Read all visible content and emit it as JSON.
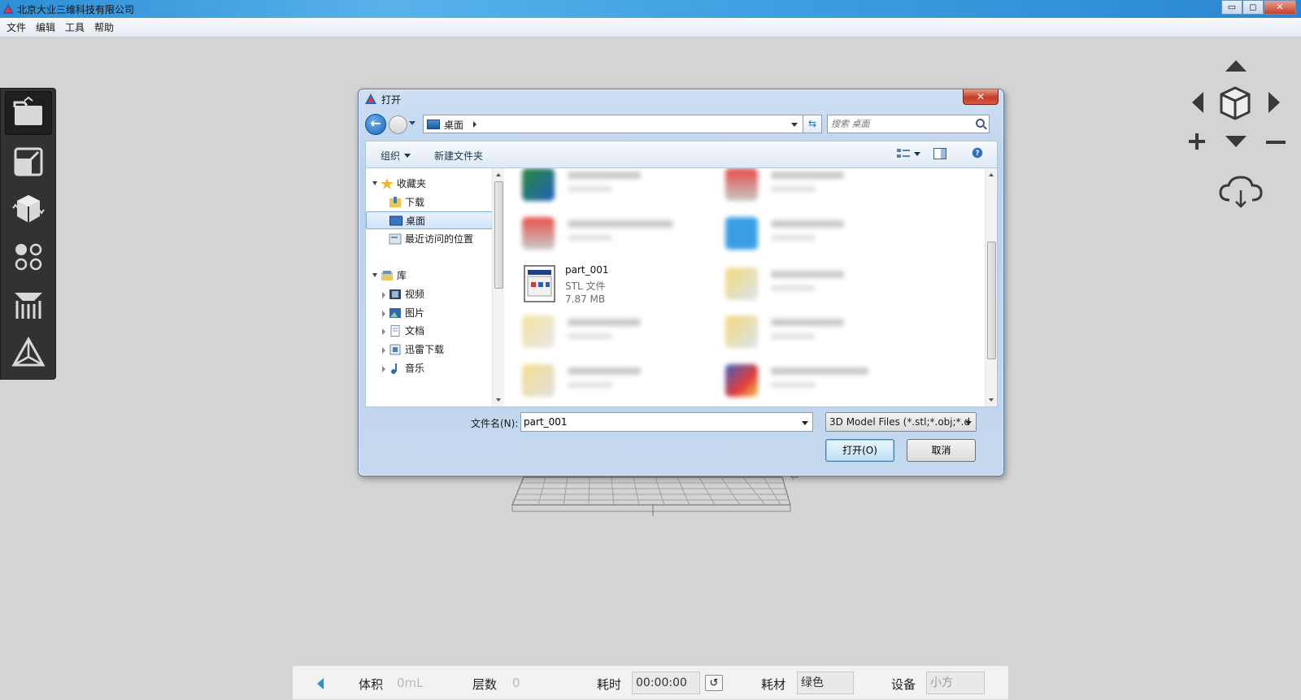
{
  "window": {
    "title": "北京大业三维科技有限公司",
    "buttons": {
      "minimize": "▭",
      "maximize": "◻",
      "close": "✕"
    }
  },
  "menu": [
    "文件",
    "编辑",
    "工具",
    "帮助"
  ],
  "left_toolbar": [
    {
      "icon": "open-file-icon",
      "active": true
    },
    {
      "icon": "scale-icon",
      "active": false
    },
    {
      "icon": "rotate-icon",
      "active": false
    },
    {
      "icon": "duplicate-icon",
      "active": false
    },
    {
      "icon": "support-icon",
      "active": false
    },
    {
      "icon": "slice-icon",
      "active": false
    }
  ],
  "view_controls": [
    "arrow-up-icon",
    "arrow-left-icon",
    "cube-icon",
    "arrow-right-icon",
    "zoom-in-icon",
    "arrow-down-icon",
    "zoom-out-icon",
    "cloud-download-icon"
  ],
  "dialog": {
    "title": "打开",
    "close": "✕",
    "address": {
      "crumb": "桌面"
    },
    "search": {
      "placeholder": "搜索 桌面"
    },
    "commands": {
      "organize": "组织",
      "new_folder": "新建文件夹"
    },
    "tree": {
      "favorites": "收藏夹",
      "downloads": "下载",
      "desktop": "桌面",
      "recent": "最近访问的位置",
      "libraries": "库",
      "videos": "视频",
      "pictures": "图片",
      "documents": "文档",
      "thunder": "迅雷下载",
      "music": "音乐"
    },
    "file": {
      "name": "part_001",
      "type": "STL 文件",
      "size": "7.87 MB"
    },
    "filename_label": "文件名(N):",
    "filename_value": "part_001",
    "filetype": "3D Model Files (*.stl;*.obj;*.d",
    "open_btn": "打开(O)",
    "cancel_btn": "取消"
  },
  "status": {
    "volume_label": "体积",
    "volume_value": "0mL",
    "layers_label": "层数",
    "layers_value": "0",
    "time_label": "耗时",
    "time_value": "00:00:00",
    "material_label": "耗材",
    "material_value": "绿色",
    "device_label": "设备",
    "device_value": "小方"
  },
  "colors": {
    "accent": "#2893d6",
    "toolbar_bg": "#303234",
    "canvas_bg": "#d4d4d4"
  }
}
